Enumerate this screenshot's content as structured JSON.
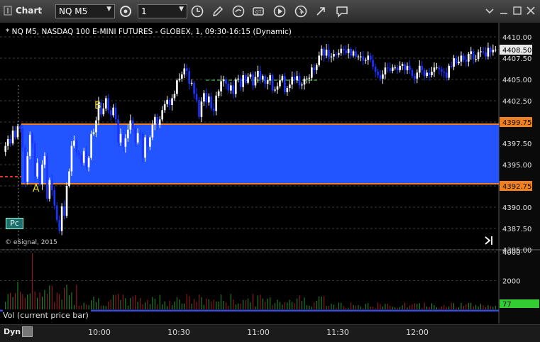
{
  "window": {
    "title": "Chart",
    "symbol": "NQ M5",
    "interval": "1"
  },
  "chart_info": "* NQ M5, NASDAQ 100 E-MINI FUTURES - GLOBEX, 1, 09:30-16:15 (Dynamic)",
  "copyright": "© eSignal, 2015",
  "side_label": "Pc",
  "vol_label": "Vol (current price bar)",
  "dyn_label": "Dyn",
  "colors": {
    "up": "#ffffff",
    "down": "#1a33ff",
    "zone": "#2255ff",
    "level": "#f08020",
    "vol": "#2a9a2a",
    "vol_down": "#aa2020"
  },
  "chart_data": [
    {
      "type": "candlestick",
      "ylim": [
        4385.0,
        4411.0
      ],
      "y_ticks": [
        4410.0,
        4407.5,
        4405.0,
        4402.5,
        4400.0,
        4397.5,
        4395.0,
        4392.5,
        4390.0,
        4387.5,
        4385.0
      ],
      "y_tick_labels": [
        "4410.00",
        "4407.50",
        "4405.00",
        "4402.50",
        "4399.75",
        "4397.50",
        "4395.00",
        "4392.75",
        "4390.00",
        "4387.50",
        "4385.00"
      ],
      "x_labels": [
        "10:00",
        "10:30",
        "11:00",
        "11:30",
        "12:00"
      ],
      "zone": {
        "top": 4399.75,
        "bottom": 4392.75
      },
      "levels": [
        4399.75,
        4392.75
      ],
      "last_price": "4408.50",
      "annotations": [
        {
          "text": "B",
          "price": 4402.2
        },
        {
          "text": "A",
          "price": 4391.7
        }
      ],
      "closes": [
        4397.2,
        4398.0,
        4397.5,
        4399.0,
        4398.2,
        4399.5,
        4399.2,
        4397.0,
        4393.0,
        4396.0,
        4398.5,
        4397.5,
        4393.6,
        4395.2,
        4392.7,
        4395.0,
        4396.0,
        4391.0,
        4393.2,
        4392.0,
        4390.2,
        4388.5,
        4387.2,
        4390.1,
        4389.0,
        4392.5,
        4394.2,
        4397.2,
        4397.8,
        4396.4,
        4396.1,
        4395.2,
        4396.6,
        4394.7,
        4395.8,
        4398.6,
        4398.8,
        4400.2,
        4402.3,
        4400.9,
        4401.6,
        4402.8,
        4401.4,
        4400.8,
        4401.7,
        4400.3,
        4397.6,
        4398.6,
        4397.1,
        4398.1,
        4399.1,
        4400.2,
        4399.2,
        4397.6,
        4398.7,
        4398.6,
        4395.8,
        4398.2,
        4397.1,
        4398.2,
        4399.7,
        4400.6,
        4399.7,
        4400.3,
        4401.4,
        4402.1,
        4402.6,
        4402.0,
        4402.8,
        4403.3,
        4404.9,
        4405.1,
        4405.6,
        4406.3,
        4406.0,
        4404.5,
        4404.6,
        4403.3,
        4402.6,
        4400.6,
        4402.4,
        4403.4,
        4402.3,
        4403.0,
        4401.6,
        4401.3,
        4403.1,
        4403.6,
        4404.8,
        4405.0,
        4404.5,
        4403.7,
        4404.3,
        4403.3,
        4405.0,
        4405.1,
        4404.1,
        4405.5,
        4404.6,
        4405.3,
        4405.6,
        4404.3,
        4405.3,
        4406.0,
        4405.0,
        4405.4,
        4404.5,
        4404.9,
        4405.5,
        4403.7,
        4403.8,
        4404.2,
        4404.9,
        4405.4,
        4403.5,
        4404.0,
        4404.4,
        4405.3,
        4404.9,
        4405.4,
        4404.3,
        4404.4,
        4405.1,
        4405.1,
        4405.2,
        4406.4,
        4406.1,
        4406.7,
        4407.8,
        4408.6,
        4407.8,
        4408.5,
        4407.6,
        4407.7,
        4408.0,
        4407.9,
        4408.1,
        4408.6,
        4408.4,
        4408.1,
        4408.6,
        4407.8,
        4408.3,
        4407.7,
        4407.7,
        4407.7,
        4407.2,
        4407.3,
        4407.8,
        4407.3,
        4406.5,
        4405.9,
        4405.5,
        4405.1,
        4405.6,
        4406.4,
        4406.3,
        4406.0,
        4406.4,
        4406.4,
        4406.1,
        4406.6,
        4406.8,
        4406.1,
        4406.6,
        4406.1,
        4405.4,
        4405.1,
        4405.8,
        4406.6,
        4406.1,
        4405.4,
        4405.8,
        4405.5,
        4405.9,
        4406.4,
        4406.4,
        4406.2,
        4405.9,
        4405.8,
        4405.2,
        4406.6,
        4406.5,
        4407.5,
        4406.9,
        4407.1,
        4407.8,
        4407.3,
        4407.1,
        4408.0,
        4408.3,
        4407.4,
        4407.4,
        4408.2,
        4408.3,
        4408.2,
        4407.7,
        4408.7,
        4408.2,
        4408.5,
        4408.5
      ]
    },
    {
      "type": "bar",
      "series": "Vol (current price bar)",
      "ylim": [
        0,
        4000
      ],
      "y_tick_labels": [
        "4000",
        "2000"
      ],
      "last_value": "77"
    }
  ]
}
